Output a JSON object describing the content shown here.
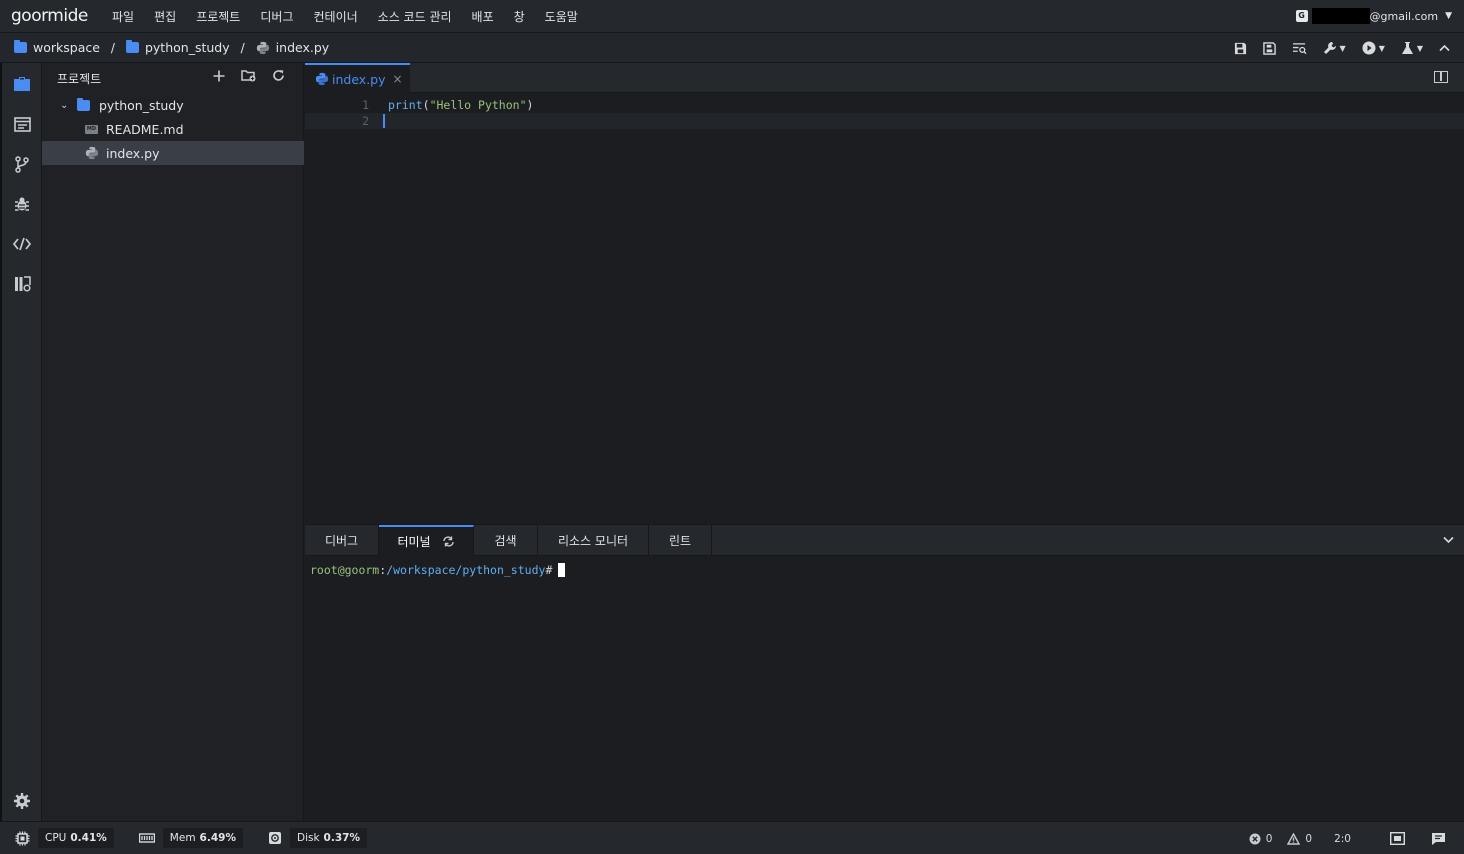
{
  "app": {
    "logo": "goormide"
  },
  "menu": [
    "파일",
    "편집",
    "프로젝트",
    "디버그",
    "컨테이너",
    "소스 코드 관리",
    "배포",
    "창",
    "도움말"
  ],
  "account": {
    "badge": "G",
    "email_suffix": "@gmail.com"
  },
  "breadcrumb": [
    {
      "label": "workspace",
      "icon": "folder-icon"
    },
    {
      "label": "python_study",
      "icon": "folder-icon"
    },
    {
      "label": "index.py",
      "icon": "python-icon"
    }
  ],
  "breadcrumb_sep": "/",
  "project_panel": {
    "title": "프로젝트",
    "tree": [
      {
        "label": "python_study",
        "type": "folder",
        "expanded": true
      },
      {
        "label": "README.md",
        "type": "markdown",
        "badge": "MD"
      },
      {
        "label": "index.py",
        "type": "python",
        "selected": true
      }
    ]
  },
  "editor": {
    "tab_label": "index.py",
    "tab_close": "×",
    "lines": [
      {
        "number": "1",
        "fn": "print",
        "open": "(",
        "str": "\"Hello Python\"",
        "close": ")"
      },
      {
        "number": "2"
      }
    ]
  },
  "bottom_panel": {
    "tabs": [
      "디버그",
      "터미널",
      "검색",
      "리소스 모니터",
      "린트"
    ],
    "active_tab": "터미널",
    "terminal": {
      "user": "root@goorm",
      "sep": ":",
      "path": "/workspace/python_study",
      "prompt": "#"
    }
  },
  "status": {
    "cpu_label": "CPU",
    "cpu_value": "0.41%",
    "mem_label": "Mem",
    "mem_value": "6.49%",
    "disk_label": "Disk",
    "disk_value": "0.37%",
    "errors": "0",
    "warnings": "0",
    "cursor_pos": "2:0"
  },
  "colors": {
    "accent": "#4a8cf1",
    "background": "#1b1d21",
    "string": "#98c379",
    "function": "#61afef"
  }
}
